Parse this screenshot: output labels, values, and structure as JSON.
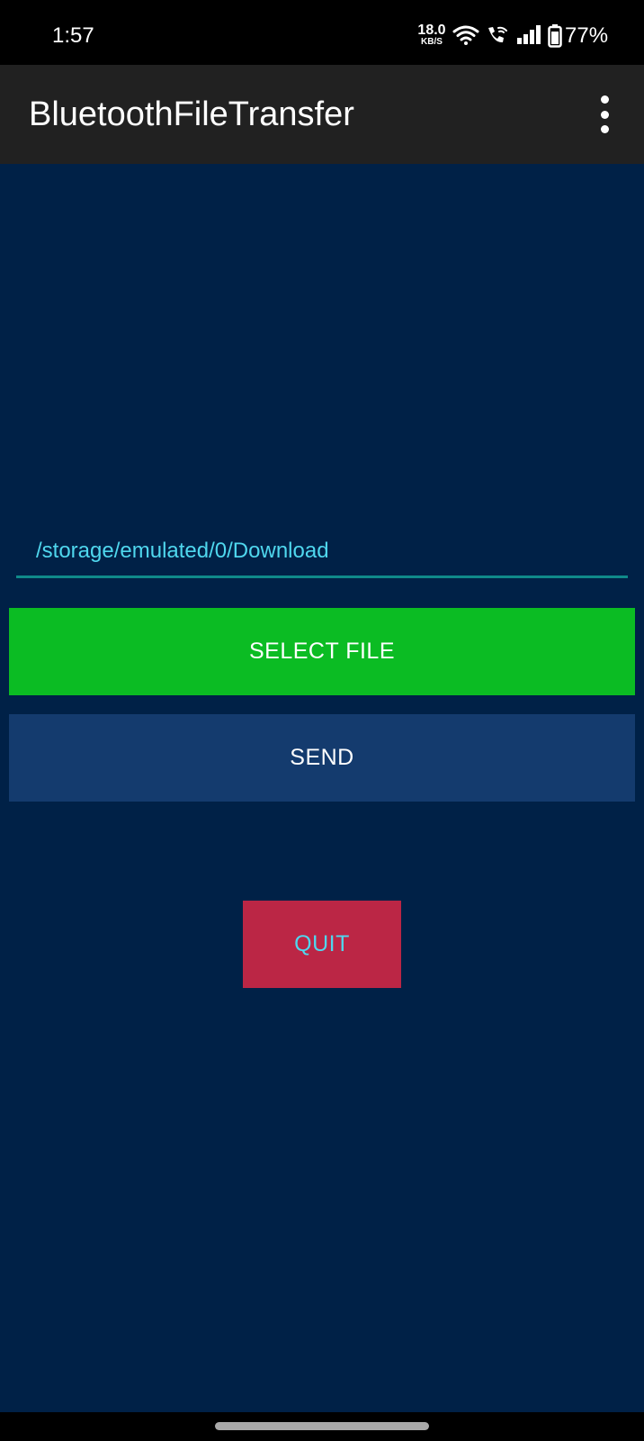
{
  "status_bar": {
    "time": "1:57",
    "net_speed_value": "18.0",
    "net_speed_unit": "KB/S",
    "battery": "77%",
    "icons": [
      "wifi-icon",
      "wifi-call-icon",
      "signal-icon",
      "battery-icon"
    ]
  },
  "app_bar": {
    "title": "BluetoothFileTransfer",
    "overflow_icon": "more-vert-icon"
  },
  "main": {
    "path_value": "/storage/emulated/0/Download",
    "select_file_label": "SELECT FILE",
    "send_label": "SEND",
    "quit_label": "QUIT"
  },
  "colors": {
    "background": "#002147",
    "app_bar": "#212121",
    "path_text": "#4fd7ee",
    "path_underline": "#0f8a8a",
    "select_file": "#0bbc23",
    "send": "#143b6e",
    "quit": "#bb2645",
    "quit_text": "#4fd7ee"
  }
}
